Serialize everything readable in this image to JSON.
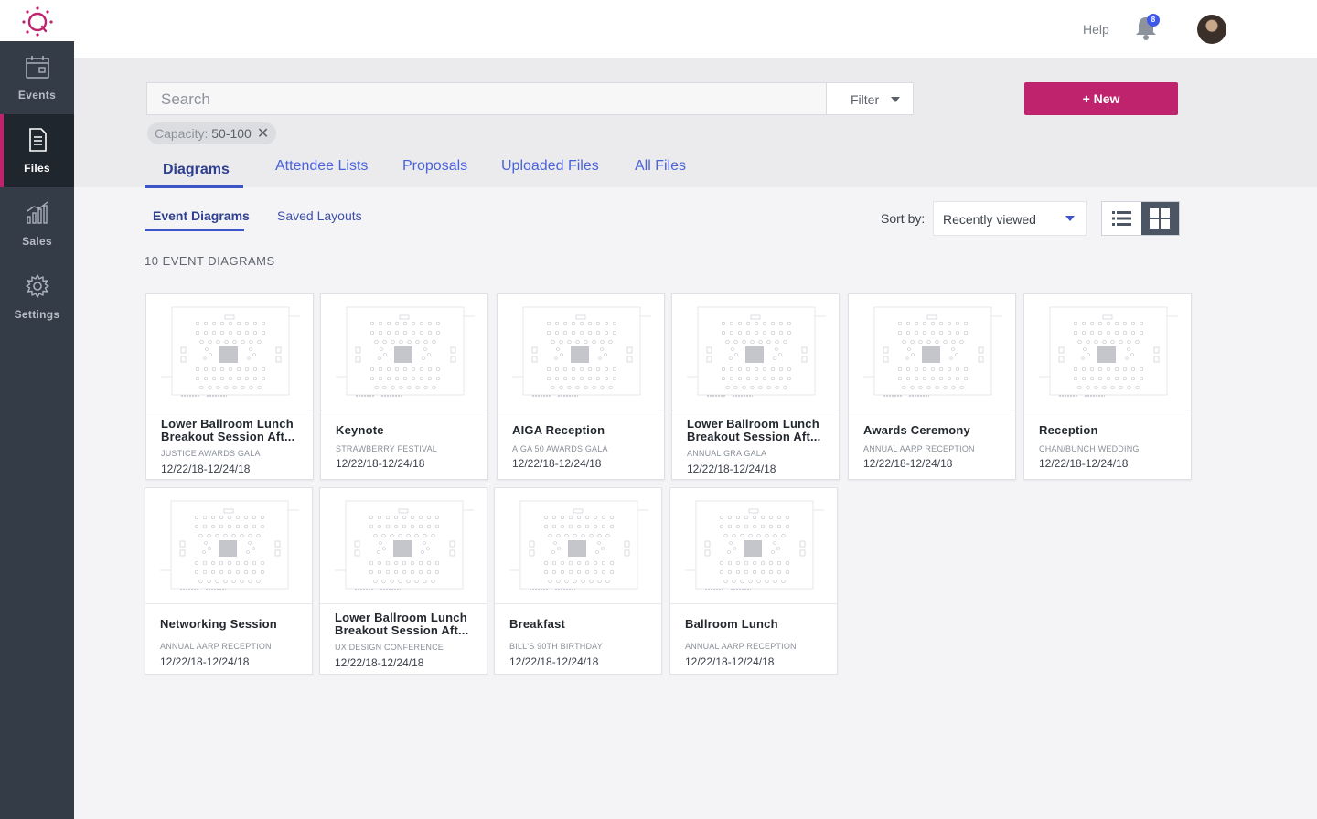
{
  "header": {
    "help_label": "Help",
    "notification_count": "8"
  },
  "sidebar": {
    "items": [
      {
        "label": "Events",
        "icon": "calendar-icon",
        "active": false
      },
      {
        "label": "Files",
        "icon": "file-icon",
        "active": true
      },
      {
        "label": "Sales",
        "icon": "bar-chart-icon",
        "active": false
      },
      {
        "label": "Settings",
        "icon": "gear-icon",
        "active": false
      }
    ]
  },
  "search": {
    "placeholder": "Search",
    "filter_label": "Filter",
    "new_button": "+ New"
  },
  "filter_chip": {
    "label": "Capacity: ",
    "value": "50-100"
  },
  "tabs": [
    "Diagrams",
    "Attendee Lists",
    "Proposals",
    "Uploaded Files",
    "All Files"
  ],
  "subtabs": [
    "Event Diagrams",
    "Saved Layouts"
  ],
  "sort": {
    "label": "Sort by:",
    "value": "Recently viewed"
  },
  "count_label": "10 EVENT DIAGRAMS",
  "colors": {
    "brand": "#c0236d",
    "sidebar": "#343c48",
    "tab_active": "#3e55c8",
    "notification_badge": "#3f58e8"
  },
  "cards": [
    {
      "title": "Lower Ballroom Lunch Breakout Session Aft...",
      "subtitle": "JUSTICE AWARDS GALA",
      "date": "12/22/18-12/24/18"
    },
    {
      "title": "Keynote",
      "subtitle": "STRAWBERRY FESTIVAL",
      "date": "12/22/18-12/24/18"
    },
    {
      "title": "AIGA Reception",
      "subtitle": "AIGA 50 AWARDS GALA",
      "date": "12/22/18-12/24/18"
    },
    {
      "title": "Lower Ballroom Lunch Breakout Session Aft...",
      "subtitle": "ANNUAL GRA GALA",
      "date": "12/22/18-12/24/18"
    },
    {
      "title": "Awards Ceremony",
      "subtitle": "ANNUAL AARP RECEPTION",
      "date": "12/22/18-12/24/18"
    },
    {
      "title": "Reception",
      "subtitle": "CHAN/BUNCH WEDDING",
      "date": "12/22/18-12/24/18"
    },
    {
      "title": "Networking Session",
      "subtitle": "ANNUAL AARP RECEPTION",
      "date": "12/22/18-12/24/18"
    },
    {
      "title": "Lower Ballroom Lunch Breakout Session Aft...",
      "subtitle": "UX DESIGN CONFERENCE",
      "date": "12/22/18-12/24/18"
    },
    {
      "title": "Breakfast",
      "subtitle": "BILL'S 90TH BIRTHDAY",
      "date": "12/22/18-12/24/18"
    },
    {
      "title": "Ballroom Lunch",
      "subtitle": "ANNUAL AARP RECEPTION",
      "date": "12/22/18-12/24/18"
    }
  ]
}
